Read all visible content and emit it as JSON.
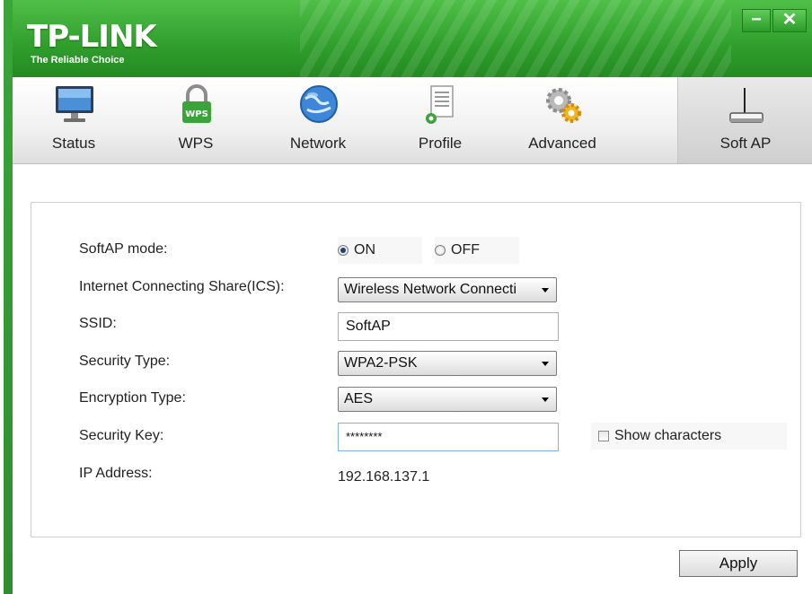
{
  "titlebar": {
    "logo": "TP-LINK",
    "tagline": "The Reliable Choice",
    "minimize_label": "−",
    "close_label": "✕"
  },
  "nav": {
    "tabs": [
      {
        "label": "Status",
        "icon": "monitor-icon"
      },
      {
        "label": "WPS",
        "icon": "wps-lock-icon"
      },
      {
        "label": "Network",
        "icon": "globe-icon"
      },
      {
        "label": "Profile",
        "icon": "document-gear-icon"
      },
      {
        "label": "Advanced",
        "icon": "gears-icon"
      },
      {
        "label": "Soft AP",
        "icon": "router-icon",
        "active": true
      }
    ]
  },
  "form": {
    "softap_mode": {
      "label": "SoftAP mode:",
      "on_label": "ON",
      "off_label": "OFF",
      "selected": "ON"
    },
    "ics": {
      "label": "Internet Connecting Share(ICS):",
      "value": "Wireless Network Connecti"
    },
    "ssid": {
      "label": "SSID:",
      "value": "SoftAP"
    },
    "security_type": {
      "label": "Security Type:",
      "value": "WPA2-PSK"
    },
    "encryption_type": {
      "label": "Encryption Type:",
      "value": "AES"
    },
    "security_key": {
      "label": "Security Key:",
      "value": "********",
      "show_characters_label": "Show characters",
      "show_characters_checked": false
    },
    "ip_address": {
      "label": "IP Address:",
      "value": "192.168.137.1"
    }
  },
  "footer": {
    "apply_label": "Apply"
  },
  "colors": {
    "brand_green": "#2f9e2c",
    "accent_blue": "#7eb4ea"
  }
}
